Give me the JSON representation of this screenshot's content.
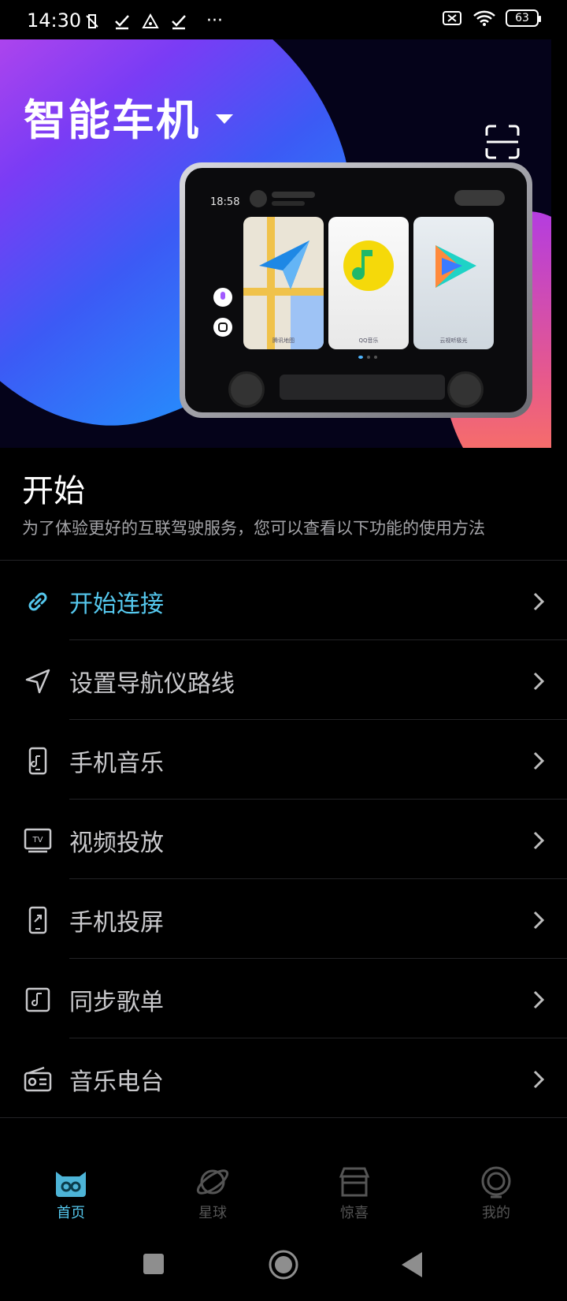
{
  "status_bar": {
    "time": "14:30",
    "battery": "63",
    "more": "···"
  },
  "hero": {
    "title": "智能车机",
    "device_screen": {
      "time": "18:58",
      "apps": [
        {
          "name": "腾讯地图",
          "icon": "tencent-map-icon"
        },
        {
          "name": "QQ音乐",
          "icon": "qq-music-icon"
        },
        {
          "name": "云视听极光",
          "icon": "video-play-icon"
        }
      ]
    }
  },
  "intro": {
    "title": "开始",
    "description": "为了体验更好的互联驾驶服务，您可以查看以下功能的使用方法"
  },
  "menu": [
    {
      "label": "开始连接",
      "icon": "link-icon",
      "active": true
    },
    {
      "label": "设置导航仪路线",
      "icon": "navigation-arrow-icon"
    },
    {
      "label": "手机音乐",
      "icon": "phone-music-icon"
    },
    {
      "label": "视频投放",
      "icon": "tv-icon"
    },
    {
      "label": "手机投屏",
      "icon": "phone-cast-icon"
    },
    {
      "label": "同步歌单",
      "icon": "playlist-icon"
    },
    {
      "label": "音乐电台",
      "icon": "radio-icon"
    }
  ],
  "bottom_nav": [
    {
      "label": "首页",
      "icon": "home-face-icon",
      "active": true
    },
    {
      "label": "星球",
      "icon": "planet-icon"
    },
    {
      "label": "惊喜",
      "icon": "store-icon"
    },
    {
      "label": "我的",
      "icon": "profile-icon"
    }
  ],
  "colors": {
    "accent": "#55c8ee",
    "background": "#000000",
    "text_secondary": "#a4a4a8"
  }
}
